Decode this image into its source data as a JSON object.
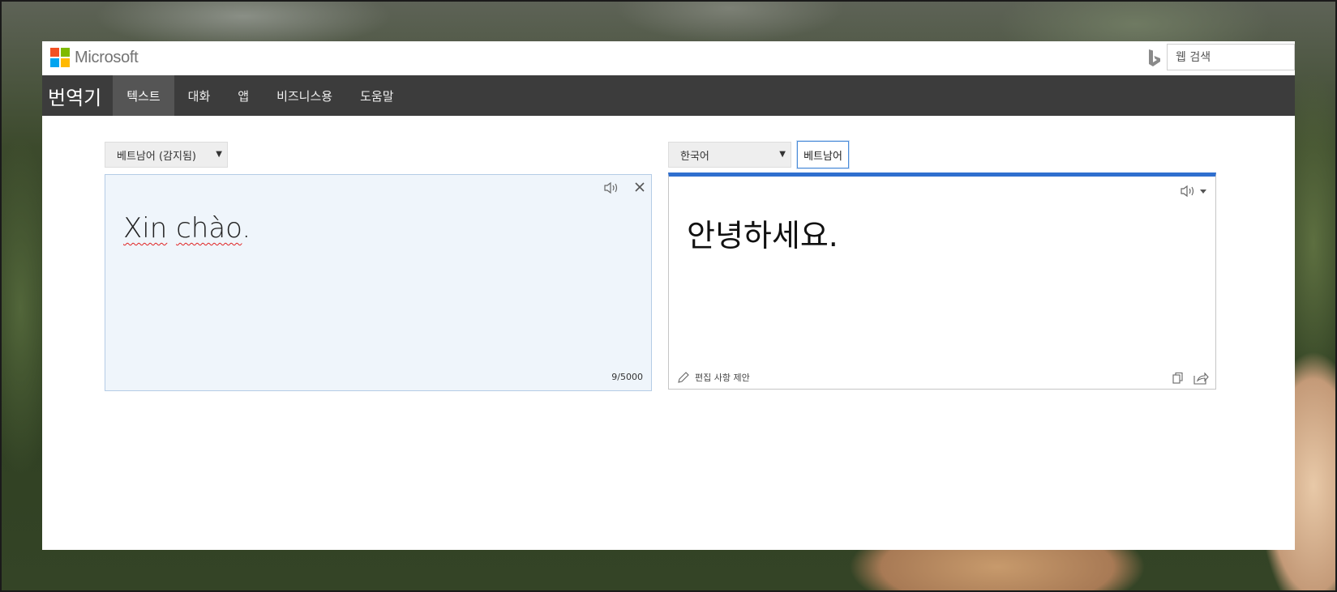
{
  "header": {
    "logo_text": "Microsoft",
    "search_placeholder": "웹 검색"
  },
  "nav": {
    "brand": "번역기",
    "tabs": [
      {
        "label": "텍스트",
        "active": true
      },
      {
        "label": "대화",
        "active": false
      },
      {
        "label": "앱",
        "active": false
      },
      {
        "label": "비즈니스용",
        "active": false
      },
      {
        "label": "도움말",
        "active": false
      }
    ]
  },
  "source": {
    "language": "베트남어 (감지됨)",
    "text_word1": "Xin",
    "text_word2": "chào",
    "text_punct": ".",
    "char_count": "9/5000"
  },
  "target": {
    "language": "한국어",
    "recent_language": "베트남어",
    "text": "안녕하세요.",
    "suggest_edit": "편집 사항 제안"
  },
  "colors": {
    "nav_bg": "#3c3c3c",
    "active_tab_bg": "#555555",
    "accent_blue": "#2f6fcf",
    "source_panel_bg": "#eff5fb"
  }
}
